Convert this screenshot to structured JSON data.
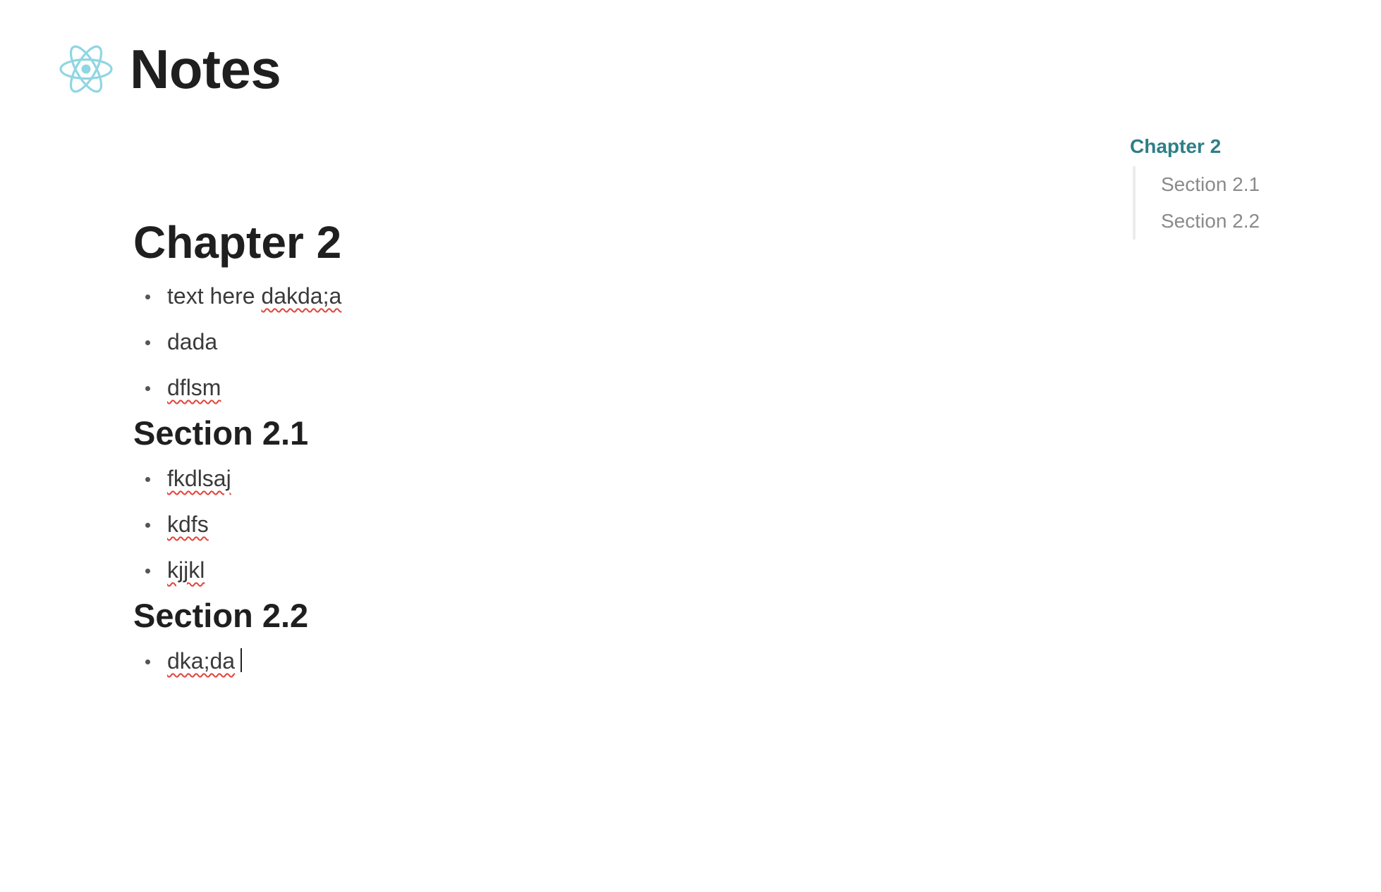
{
  "header": {
    "title": "Notes",
    "logo_icon": "react-atom-icon",
    "logo_color": "#8fd6e3"
  },
  "document": {
    "chapter_title": "Chapter 2",
    "chapter_items": [
      "text here",
      "dakda;a",
      "dada",
      "dflsm"
    ],
    "section_1": {
      "title": "Section 2.1",
      "items": [
        "fkdlsaj",
        "kdfs",
        "kjjkl"
      ]
    },
    "section_2": {
      "title": "Section 2.2",
      "items": [
        "dka;da"
      ]
    }
  },
  "toc": {
    "active_color": "#2e7f86",
    "chapter": "Chapter 2",
    "sections": [
      "Section 2.1",
      "Section 2.2"
    ]
  }
}
